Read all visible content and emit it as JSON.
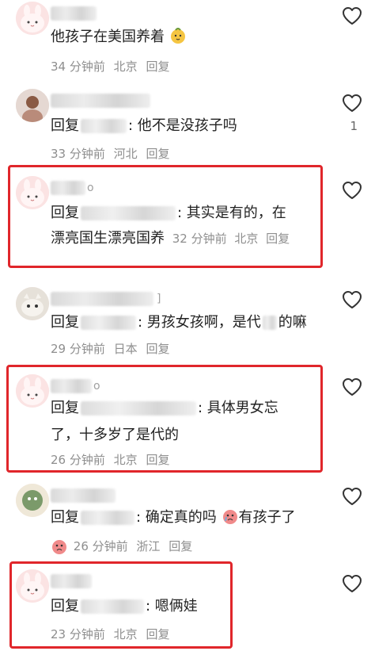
{
  "comments": [
    {
      "text": "他孩子在美国养着",
      "time": "34 分钟前",
      "location": "北京",
      "reply_label": "回复"
    },
    {
      "user_suffix": "",
      "reply_prefix": "回复",
      "text": ": 他不是没孩子吗",
      "time": "33 分钟前",
      "location": "河北",
      "reply_label": "回复",
      "likes": "1"
    },
    {
      "user_suffix": "o",
      "reply_prefix": "回复",
      "text_line1": ": 其实是有的，在",
      "text_line2": "漂亮国生漂亮国养",
      "time": "32 分钟前",
      "location": "北京",
      "reply_label": "回复"
    },
    {
      "user_suffix": "]",
      "reply_prefix": "回复",
      "text_a": ": 男孩女孩啊，是代",
      "text_b": "的嘛",
      "time": "29 分钟前",
      "location": "日本",
      "reply_label": "回复"
    },
    {
      "user_suffix": "o",
      "reply_prefix": "回复",
      "text_line1": ": 具体男女忘",
      "text_line2": "了，十多岁了是代的",
      "time": "26 分钟前",
      "location": "北京",
      "reply_label": "回复"
    },
    {
      "reply_prefix": "回复",
      "text_a": ": 确定真的吗",
      "text_b": "有孩子了",
      "time": "26 分钟前",
      "location": "浙江",
      "reply_label": "回复"
    },
    {
      "reply_prefix": "回复",
      "text": ": 嗯俩娃",
      "time": "23 分钟前",
      "location": "北京",
      "reply_label": "回复"
    }
  ],
  "colors": {
    "highlight": "#e0262b",
    "meta": "#8e8e8e",
    "text": "#222222"
  },
  "icons": {
    "like": "heart-outline-icon"
  }
}
